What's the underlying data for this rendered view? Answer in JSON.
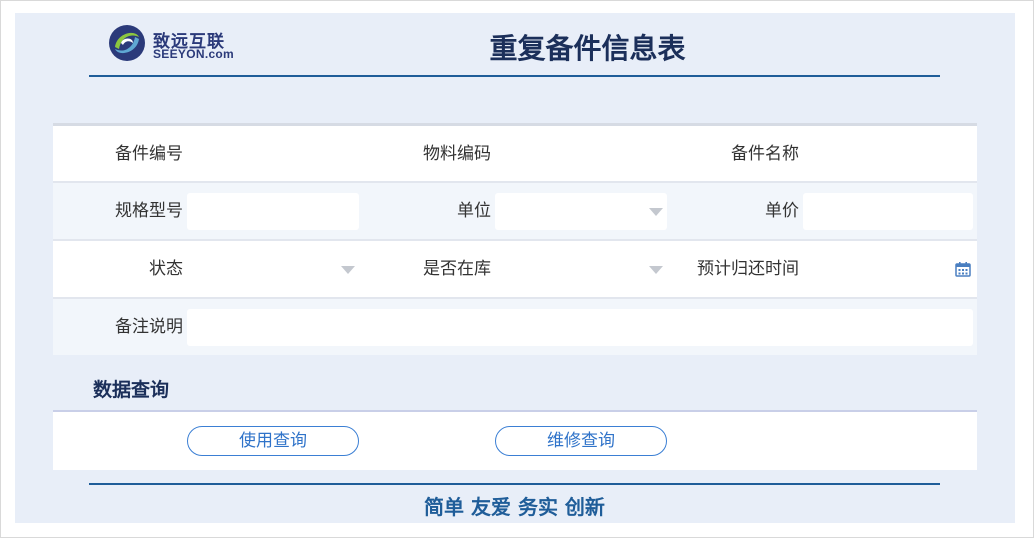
{
  "header": {
    "logo_cn": "致远互联",
    "logo_en": "SEEYON.com",
    "title": "重复备件信息表"
  },
  "form": {
    "spare_no_label": "备件编号",
    "material_code_label": "物料编码",
    "spare_name_label": "备件名称",
    "spec_label": "规格型号",
    "unit_label": "单位",
    "unit_price_label": "单价",
    "status_label": "状态",
    "in_stock_label": "是否在库",
    "return_time_label": "预计归还时间",
    "remark_label": "备注说明"
  },
  "query": {
    "section_title": "数据查询",
    "use_query_label": "使用查询",
    "repair_query_label": "维修查询"
  },
  "footer": {
    "slogan": "简单 友爱 务实 创新"
  },
  "colors": {
    "accent": "#1f5d99",
    "button": "#3b7fd4",
    "background": "#e8eef8"
  }
}
